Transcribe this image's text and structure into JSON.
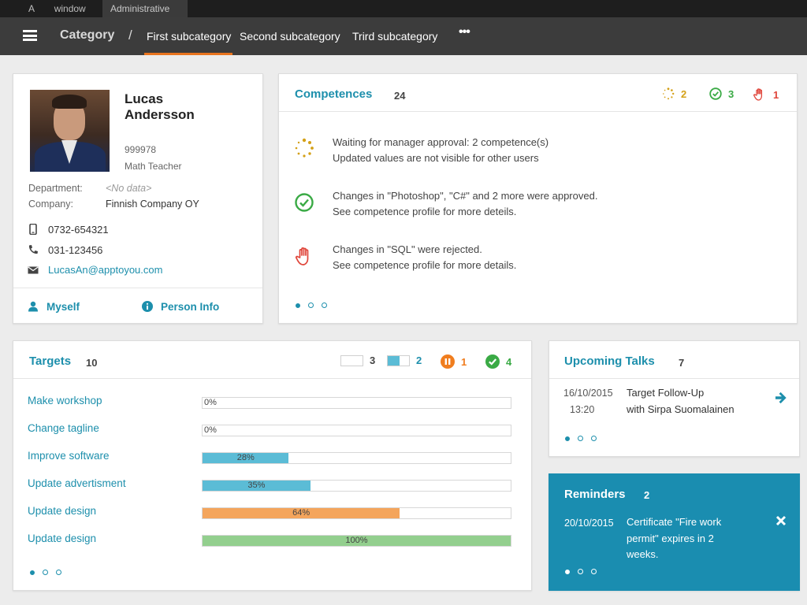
{
  "window_tabs": [
    "A",
    "window",
    "Administrative"
  ],
  "nav": {
    "category": "Category",
    "separator": "/",
    "items": [
      "First subcategory",
      "Second subcategory",
      "Trird subcategory"
    ],
    "more": "•••"
  },
  "profile": {
    "first_name": "Lucas",
    "last_name": "Andersson",
    "id": "999978",
    "role": "Math Teacher",
    "department_label": "Department:",
    "department_value": "<No data>",
    "company_label": "Company:",
    "company_value": "Finnish Company OY",
    "mobile": "0732-654321",
    "phone": "031-123456",
    "email": "LucasAn@apptoyou.com",
    "action_myself": "Myself",
    "action_person_info": "Person Info"
  },
  "competences": {
    "title": "Competences",
    "count": "24",
    "stats": {
      "pending": "2",
      "approved": "3",
      "rejected": "1"
    },
    "rows": [
      {
        "icon": "pending-icon",
        "line1": "Waiting for manager approval: 2 competence(s)",
        "line2": "Updated values are not visible for other users"
      },
      {
        "icon": "approved-icon",
        "line1": "Changes in \"Photoshop\", \"C#\" and 2 more were approved.",
        "line2": "See competence profile for more deteils."
      },
      {
        "icon": "rejected-hand-icon",
        "line1": "Changes in \"SQL\" were rejected.",
        "line2": "See competence profile for more details."
      }
    ]
  },
  "targets": {
    "title": "Targets",
    "count": "10",
    "stats": {
      "not_started": "3",
      "in_progress": "2",
      "paused": "1",
      "done": "4"
    },
    "items": [
      {
        "label": "Make workshop",
        "progress": 0,
        "pct": "0%",
        "color": ""
      },
      {
        "label": "Change tagline",
        "progress": 0,
        "pct": "0%",
        "color": ""
      },
      {
        "label": "Improve software",
        "progress": 28,
        "pct": "28%",
        "color": "#5bbcd6"
      },
      {
        "label": "Update advertisment",
        "progress": 35,
        "pct": "35%",
        "color": "#5bbcd6"
      },
      {
        "label": "Update design",
        "progress": 64,
        "pct": "64%",
        "color": "#f4a55c"
      },
      {
        "label": "Update design",
        "progress": 100,
        "pct": "100%",
        "color": "#93cf8e"
      }
    ]
  },
  "talks": {
    "title": "Upcoming Talks",
    "count": "7",
    "date": "16/10/2015",
    "time": "13:20",
    "line1": "Target Follow-Up",
    "line2": "with Sirpa Suomalainen"
  },
  "reminders": {
    "title": "Reminders",
    "count": "2",
    "date": "20/10/2015",
    "text": "Certificate \"Fire work permit\"  expires in 2 weeks."
  },
  "colors": {
    "accent": "#1d8fac",
    "pending": "#d4a017",
    "approved": "#3aaa45",
    "rejected": "#e0453a",
    "paused": "#f07d1e"
  }
}
